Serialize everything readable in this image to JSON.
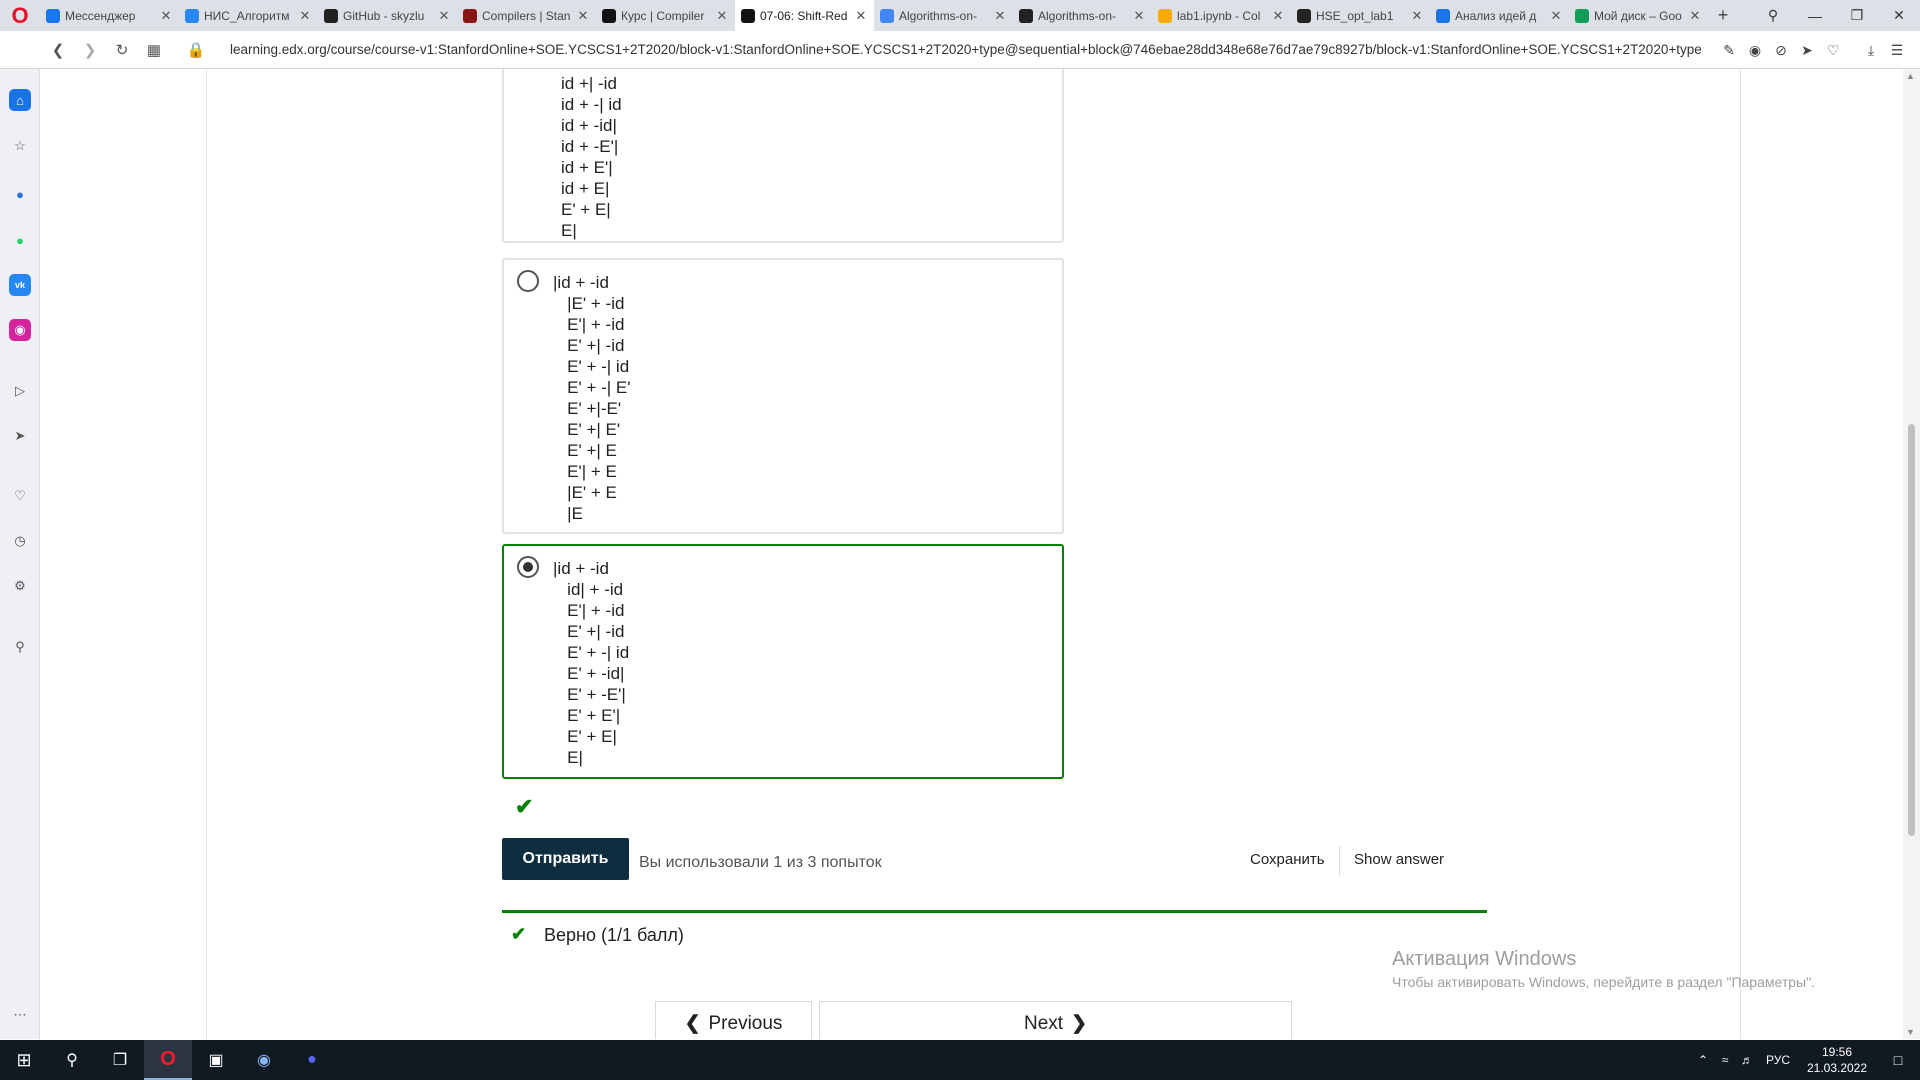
{
  "browser": {
    "tabs": [
      {
        "title": "Мессенджер",
        "icon": "messenger-icon",
        "color": "#1877f2"
      },
      {
        "title": "НИС_Алгоритм",
        "icon": "vk-icon",
        "color": "#2787f5"
      },
      {
        "title": "GitHub - skyzlu",
        "icon": "github-icon",
        "color": "#222222"
      },
      {
        "title": "Compilers | Stan",
        "icon": "stanford-icon",
        "color": "#8c1515"
      },
      {
        "title": "Курс | Compiler",
        "icon": "edx-icon",
        "color": "#111111"
      },
      {
        "title": "07-06: Shift-Red",
        "icon": "edx-icon",
        "color": "#111111",
        "active": true
      },
      {
        "title": "Algorithms-on-",
        "icon": "google-colab-icon",
        "color": "#4285f4"
      },
      {
        "title": "Algorithms-on-",
        "icon": "github-icon",
        "color": "#222222"
      },
      {
        "title": "lab1.ipynb - Col",
        "icon": "colab-icon",
        "color": "#f9ab00"
      },
      {
        "title": "HSE_opt_lab1",
        "icon": "github-icon",
        "color": "#222222"
      },
      {
        "title": "Анализ идей д",
        "icon": "site-icon",
        "color": "#1a73e8"
      },
      {
        "title": "Мой диск – Goo",
        "icon": "google-drive-icon",
        "color": "#0f9d58"
      }
    ],
    "url": "learning.edx.org/course/course-v1:StanfordOnline+SOE.YCSCS1+2T2020/block-v1:StanfordOnline+SOE.YCSCS1+2T2020+type@sequential+block@746ebae28dd348e68e76d7ae79c8927b/block-v1:StanfordOnline+SOE.YCSCS1+2T2020+type"
  },
  "question": {
    "options": [
      {
        "selected": false,
        "partial": true,
        "lines": [
          "id +| -id",
          "id + -| id",
          "id + -id|",
          "id + -E'|",
          "id + E'|",
          "id + E|",
          "E' + E|",
          "E|"
        ]
      },
      {
        "selected": false,
        "lines": [
          "|id + -id",
          "   |E' + -id",
          "   E'| + -id",
          "   E' +| -id",
          "   E' + -| id",
          "   E' + -| E'",
          "   E' +|-E'",
          "   E' +| E'",
          "   E' +| E",
          "   E'| + E",
          "   |E' + E",
          "   |E"
        ]
      },
      {
        "selected": true,
        "lines": [
          "|id + -id",
          "   id| + -id",
          "   E'| + -id",
          "   E' +| -id",
          "   E' + -| id",
          "   E' + -id|",
          "   E' + -E'|",
          "   E' + E'|",
          "   E' + E|",
          "   E|"
        ]
      }
    ],
    "status_icon": "checkmark-icon",
    "submit_label": "Отправить",
    "attempts_text": "Вы использовали 1 из 3 попыток",
    "save_label": "Сохранить",
    "show_answer_label": "Show answer",
    "result_text": "Верно (1/1 балл)",
    "accent_color": "#008100"
  },
  "navigation": {
    "previous_label": "Previous",
    "next_label": "Next"
  },
  "windows_watermark": {
    "title": "Активация Windows",
    "subtitle": "Чтобы активировать Windows, перейдите в раздел \"Параметры\"."
  },
  "taskbar": {
    "language": "РУС",
    "time": "19:56",
    "date": "21.03.2022"
  }
}
